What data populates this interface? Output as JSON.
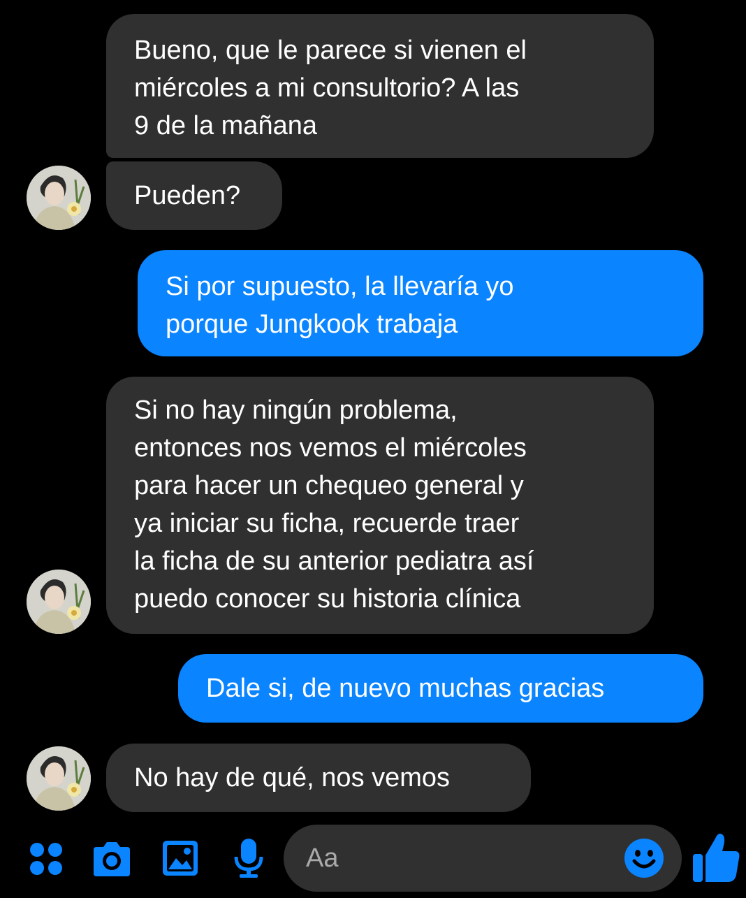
{
  "colors": {
    "background": "#000000",
    "incoming_bubble": "#303030",
    "outgoing_bubble": "#0a84ff",
    "accent": "#0a84ff",
    "placeholder_text": "#a9a9a9"
  },
  "messages": [
    {
      "direction": "incoming",
      "text": "Bueno, que le parece si vienen el\nmiércoles a mi consultorio? A las\n9 de la mañana"
    },
    {
      "direction": "incoming",
      "text": "Pueden?"
    },
    {
      "direction": "outgoing",
      "text": "Si por supuesto, la llevaría yo\nporque Jungkook trabaja"
    },
    {
      "direction": "incoming",
      "text": "Si no hay ningún problema,\nentonces nos vemos el miércoles\npara hacer un chequeo general y\nya iniciar su ficha, recuerde traer\nla ficha de su anterior pediatra así\npuedo conocer su historia clínica"
    },
    {
      "direction": "outgoing",
      "text": "Dale si, de nuevo muchas gracias"
    },
    {
      "direction": "incoming",
      "text": "No hay de qué, nos vemos"
    }
  ],
  "composer": {
    "placeholder": "Aa",
    "icons": [
      "apps-icon",
      "camera-icon",
      "gallery-icon",
      "microphone-icon",
      "emoji-icon",
      "thumbs-up-icon"
    ]
  }
}
